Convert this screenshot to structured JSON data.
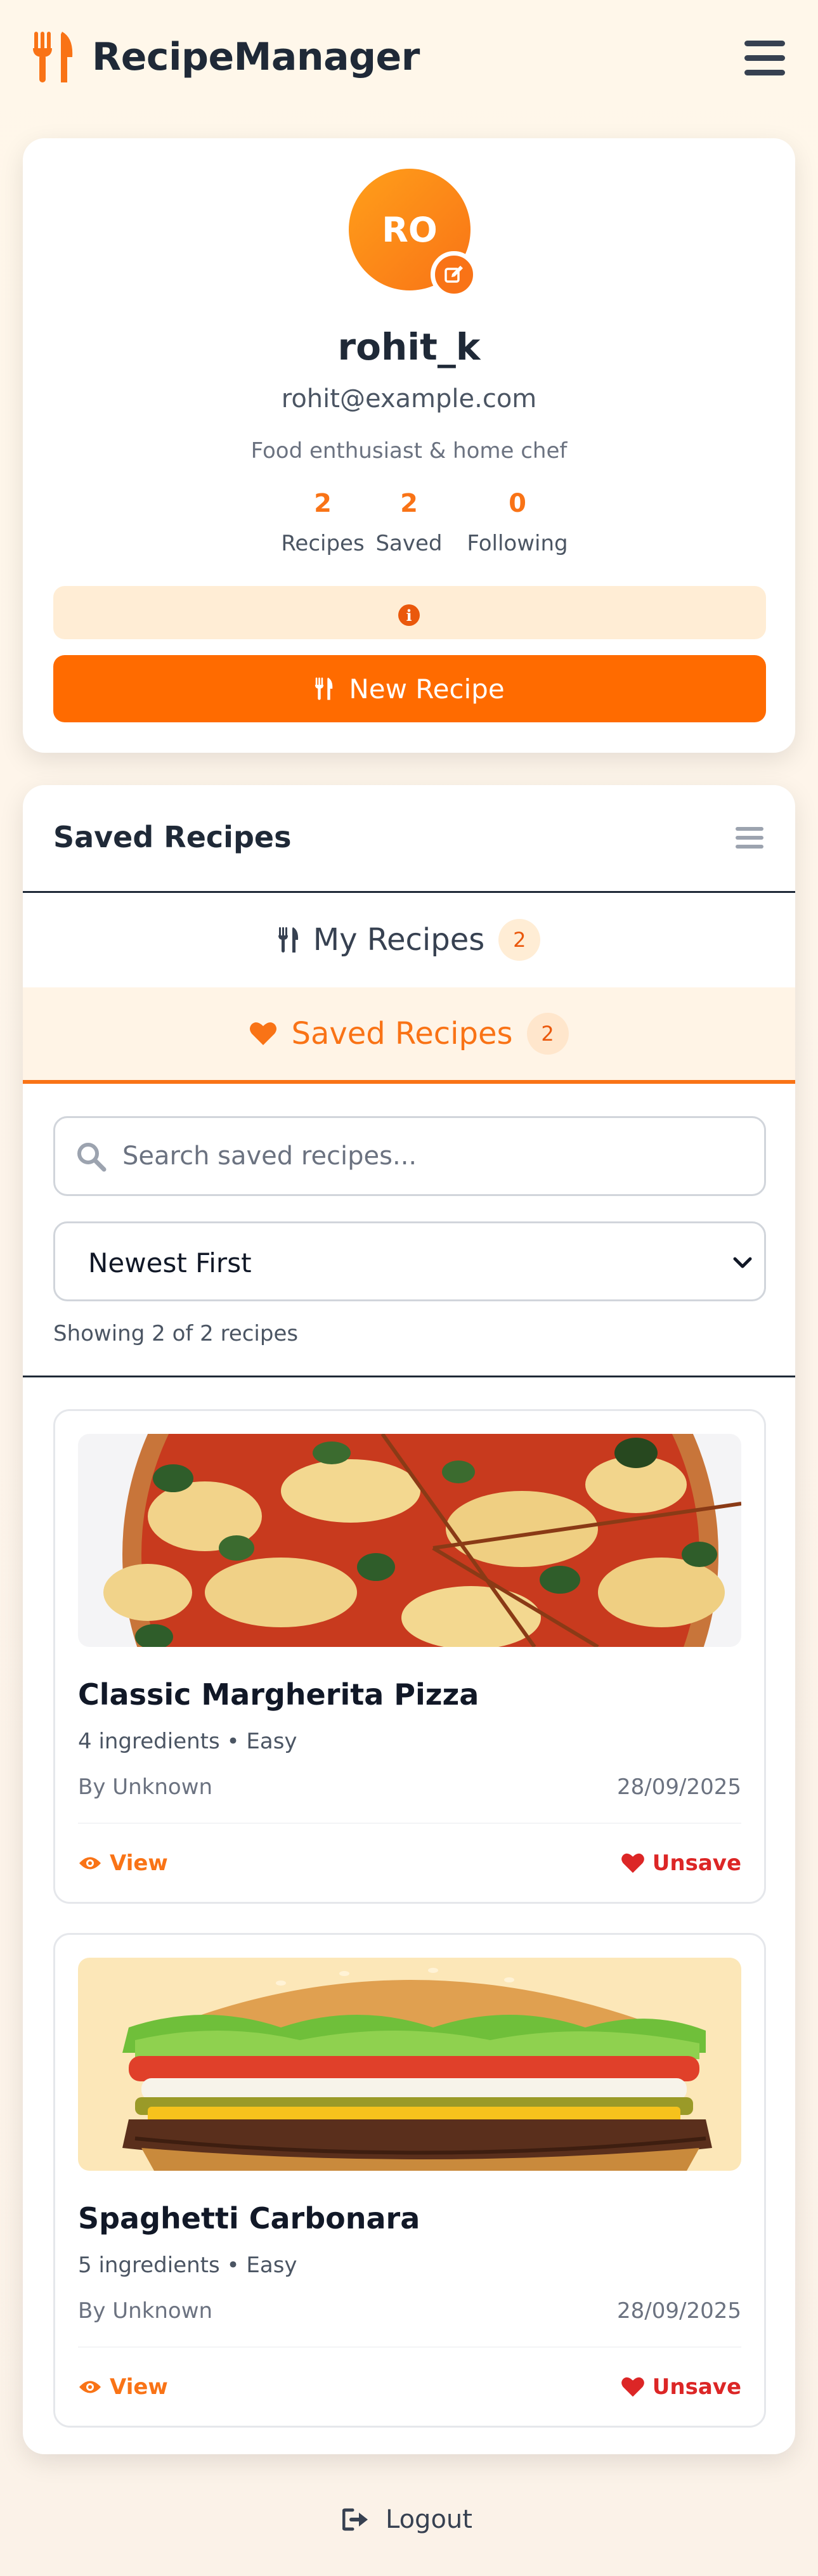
{
  "header": {
    "brand": "RecipeManager",
    "brand_icon": "utensils-icon",
    "menu_icon": "hamburger-menu-icon"
  },
  "profile": {
    "initials": "RO",
    "username": "rohit_k",
    "email": "rohit@example.com",
    "bio": "Food enthusiast & home chef",
    "stats": [
      {
        "value": "2",
        "label": "Recipes"
      },
      {
        "value": "2",
        "label": "Saved"
      },
      {
        "value": "0",
        "label": "Following"
      }
    ],
    "new_recipe_label": "New Recipe"
  },
  "recipes_section": {
    "title": "Saved Recipes",
    "tabs": [
      {
        "label": "My Recipes",
        "count": "2",
        "active": false
      },
      {
        "label": "Saved Recipes",
        "count": "2",
        "active": true
      }
    ],
    "search_placeholder": "Search saved recipes...",
    "sort_selected": "Newest First",
    "showing_text": "Showing 2 of 2 recipes",
    "recipes": [
      {
        "title": "Classic Margherita Pizza",
        "meta": "4 ingredients • Easy",
        "author": "By Unknown",
        "date": "28/09/2025",
        "view_label": "View",
        "unsave_label": "Unsave"
      },
      {
        "title": "Spaghetti Carbonara",
        "meta": "5 ingredients • Easy",
        "author": "By Unknown",
        "date": "28/09/2025",
        "view_label": "View",
        "unsave_label": "Unsave"
      }
    ]
  },
  "logout_label": "Logout",
  "colors": {
    "accent": "#f97316",
    "primary_button": "#ff6b00",
    "danger": "#dc2626",
    "background": "#fdf4ea"
  }
}
